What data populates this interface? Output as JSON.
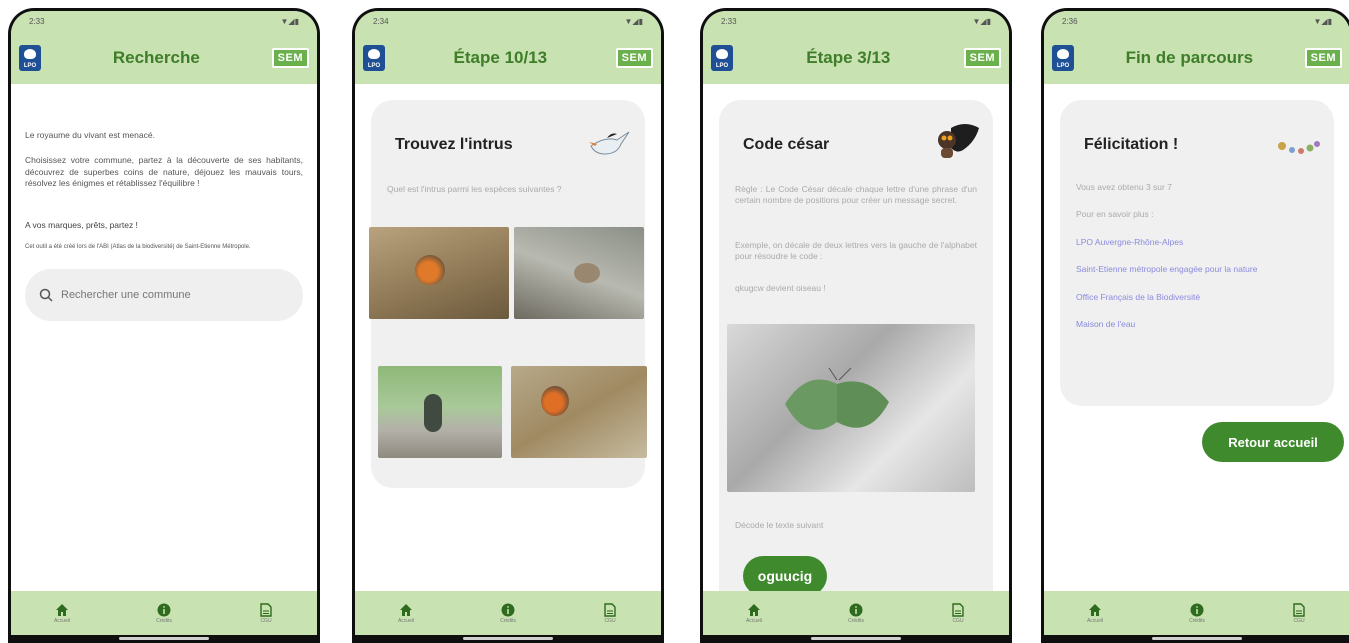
{
  "screens": {
    "s1": {
      "time": "2:33",
      "title": "Recherche",
      "sem": "SEM",
      "logo_text": "LPO",
      "intro": "Le royaume du vivant est menacé.",
      "body": "Choisissez votre commune, partez à la découverte de ses habitants, découvrez de superbes coins de nature, déjouez les mauvais tours, résolvez les énigmes et rétablissez l'équilibre !",
      "cta": "A vos marques, prêts, partez !",
      "note": "Cet outil a été créé lors de l'ABI (Atlas de la biodiversité) de Saint-Etienne Métropole.",
      "search_placeholder": "Rechercher une commune"
    },
    "s2": {
      "time": "2:34",
      "title": "Étape 10/13",
      "sem": "SEM",
      "logo_text": "LPO",
      "card_title": "Trouvez l'intrus",
      "question": "Quel est l'intrus parmi les espèces suivantes ?"
    },
    "s3": {
      "time": "2:33",
      "title": "Étape 3/13",
      "sem": "SEM",
      "logo_text": "LPO",
      "card_title": "Code césar",
      "rule": "Règle : Le Code César décale chaque lettre d'une phrase d'un certain nombre de positions pour créer un message secret.",
      "example": "Exemple, on décale de deux lettres vers la gauche de l'alphabet pour résoudre le code :",
      "example2": "qkugcw devient oiseau !",
      "decode": "Décode le texte suivant",
      "code": "oguucig"
    },
    "s4": {
      "time": "2:36",
      "title": "Fin de parcours",
      "sem": "SEM",
      "logo_text": "LPO",
      "card_title": "Félicitation !",
      "score": "Vous avez obtenu 3 sur 7",
      "more": "Pour en savoir plus :",
      "links": [
        "LPO Auvergne-Rhône-Alpes",
        "Saint-Etienne métropole engagée pour la nature",
        "Office Français de la Biodiversité",
        "Maison de l'eau"
      ],
      "back": "Retour accueil"
    }
  },
  "nav": {
    "home": "Accueil",
    "credits": "Crédits",
    "cgu": "CGU"
  },
  "colors": {
    "header": "#c8e2b1",
    "accent": "#3f8a2d",
    "title": "#3f7d2a"
  }
}
